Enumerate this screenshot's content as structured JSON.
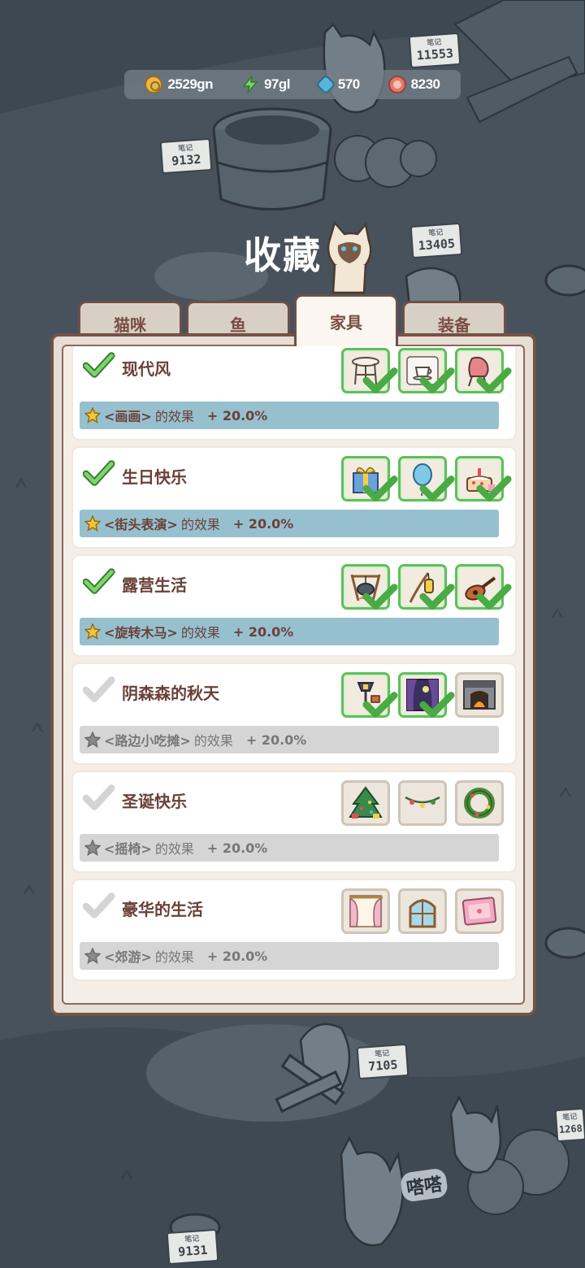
{
  "currency": [
    {
      "icon": "gold-coin-icon",
      "value": "2529gn"
    },
    {
      "icon": "energy-bolt-icon",
      "value": "97gl"
    },
    {
      "icon": "gem-icon",
      "value": "570"
    },
    {
      "icon": "fish-token-icon",
      "value": "8230"
    }
  ],
  "title": "收藏",
  "tabs": [
    {
      "label": "猫咪",
      "active": false
    },
    {
      "label": "鱼",
      "active": false
    },
    {
      "label": "家具",
      "active": true
    },
    {
      "label": "装备",
      "active": false
    }
  ],
  "signs": [
    "11553",
    "9132",
    "13405",
    "7105",
    "1268",
    "9131"
  ],
  "sign_caption": "笔记",
  "bg_text": "嗒嗒",
  "sets": [
    {
      "name": "现代风",
      "complete": true,
      "effect_target": "<画画>",
      "effect_suffix": "的效果",
      "bonus": "+ 20.0%",
      "items": [
        {
          "icon": "round-table-icon",
          "owned": true
        },
        {
          "icon": "teacup-icon",
          "owned": true
        },
        {
          "icon": "pink-chair-icon",
          "owned": true
        }
      ]
    },
    {
      "name": "生日快乐",
      "complete": true,
      "effect_target": "<街头表演>",
      "effect_suffix": "的效果",
      "bonus": "+ 20.0%",
      "items": [
        {
          "icon": "gift-box-icon",
          "owned": true
        },
        {
          "icon": "balloon-icon",
          "owned": true
        },
        {
          "icon": "birthday-cake-icon",
          "owned": true
        }
      ]
    },
    {
      "name": "露营生活",
      "complete": true,
      "effect_target": "<旋转木马>",
      "effect_suffix": "的效果",
      "bonus": "+ 20.0%",
      "items": [
        {
          "icon": "campfire-pot-icon",
          "owned": true
        },
        {
          "icon": "hanging-lantern-icon",
          "owned": true
        },
        {
          "icon": "guitar-icon",
          "owned": true
        }
      ]
    },
    {
      "name": "阴森森的秋天",
      "complete": false,
      "effect_target": "<路边小吃摊>",
      "effect_suffix": "的效果",
      "bonus": "+ 20.0%",
      "items": [
        {
          "icon": "street-lamp-icon",
          "owned": true
        },
        {
          "icon": "spooky-window-icon",
          "owned": true
        },
        {
          "icon": "fireplace-icon",
          "owned": false
        }
      ]
    },
    {
      "name": "圣诞快乐",
      "complete": false,
      "effect_target": "<摇椅>",
      "effect_suffix": "的效果",
      "bonus": "+ 20.0%",
      "items": [
        {
          "icon": "christmas-tree-icon",
          "owned": false
        },
        {
          "icon": "garland-lights-icon",
          "owned": false
        },
        {
          "icon": "wreath-icon",
          "owned": false
        }
      ]
    },
    {
      "name": "豪华的生活",
      "complete": false,
      "effect_target": "<郊游>",
      "effect_suffix": "的效果",
      "bonus": "+ 20.0%",
      "items": [
        {
          "icon": "curtain-icon",
          "owned": false
        },
        {
          "icon": "arched-window-icon",
          "owned": false
        },
        {
          "icon": "pink-rug-icon",
          "owned": false
        }
      ]
    }
  ],
  "colors": {
    "background": "#48535d",
    "panel_border": "#735248",
    "active_effect": "#97c0cf",
    "inactive_effect": "#d5d5d5",
    "owned_border": "#5fbf5a",
    "text_brown": "#6a4038"
  }
}
